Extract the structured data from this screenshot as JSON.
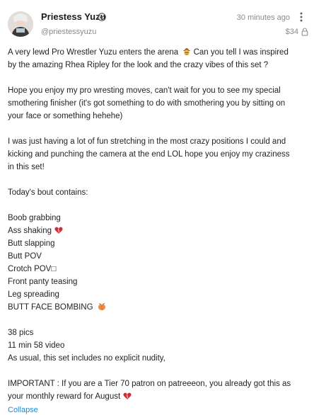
{
  "author": {
    "name": "Priestess Yuzu",
    "handle": "@priestessyuzu",
    "avatar_icon": "avatar-photo",
    "verified_icon": "verified-check-icon"
  },
  "meta": {
    "timestamp": "30 minutes ago",
    "price": "$34",
    "lock_icon": "lock-icon",
    "more_icon": "more-icon"
  },
  "body": {
    "p1_line1": "A very lewd Pro Wrestler Yuzu enters the arena",
    "p1_line1b": "Can you tell I was inspired",
    "p1_line2": "by the amazing Rhea Ripley for the look and the crazy vibes of this set ?",
    "p2_line1": "Hope you enjoy my pro wresting moves, can't wait for you to see my special",
    "p2_line2": "smothering finisher (it's got something to do with smothering you by sitting on",
    "p2_line3": "your face or something hehehe)",
    "p3_line1": "I was just having a lot of fun stretching in the most crazy positions I could and",
    "p3_line2": "kicking and punching the camera at the end LOL hope you enjoy my craziness",
    "p3_line3": "in this set!",
    "bout_heading": "Today's bout contains:",
    "bout_items": [
      "Boob grabbing",
      "Ass shaking",
      "Butt slapping",
      "Butt POV",
      "Crotch POV□",
      "Front panty teasing",
      "Leg spreading",
      "BUTT FACE BOMBING"
    ],
    "stats_pics": "38 pics",
    "stats_video": "11 min 58 video",
    "stats_note": "As usual, this set includes no explicit nudity,",
    "important_line1": "IMPORTANT : If you are a Tier 70 patron on patreeeon, you already got this as",
    "important_line2": "your monthly reward for August"
  },
  "emojis": {
    "cowboy": "cowboy-face-emoji",
    "heart": "heart-emoji",
    "peach": "peach-emoji"
  },
  "colors": {
    "link": "#1f8ad6",
    "muted": "#8a8a8a",
    "heart": "#d42a35",
    "peach": "#f08a3e"
  },
  "actions": {
    "collapse_label": "Collapse"
  }
}
